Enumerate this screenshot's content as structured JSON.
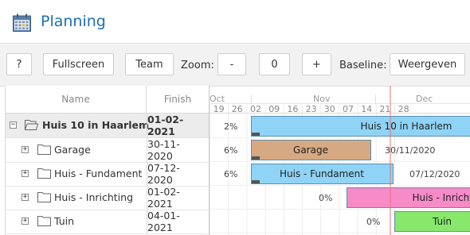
{
  "app": {
    "title": "Planning",
    "icon": "calendar-icon"
  },
  "toolbar": {
    "help_label": "?",
    "fullscreen_label": "Fullscreen",
    "team_label": "Team",
    "zoom_label": "Zoom:",
    "zoom_out_label": "-",
    "zoom_value": "0",
    "zoom_in_label": "+",
    "baseline_label": "Baseline:",
    "baseline_value": "Weergeven"
  },
  "grid": {
    "columns": {
      "name": "Name",
      "finish": "Finish"
    },
    "rows": [
      {
        "name": "Huis 10 in Haarlem",
        "finish": "01-02-2021",
        "toggle": "−",
        "expanded": true,
        "level": 0
      },
      {
        "name": "Garage",
        "finish": "30-11-2020",
        "toggle": "+",
        "expanded": false,
        "level": 1
      },
      {
        "name": "Huis - Fundament",
        "finish": "07-12-2020",
        "toggle": "+",
        "expanded": false,
        "level": 1
      },
      {
        "name": "Huis - Inrichting",
        "finish": "01-02-2021",
        "toggle": "+",
        "expanded": false,
        "level": 1
      },
      {
        "name": "Tuin",
        "finish": "04-01-2021",
        "toggle": "+",
        "expanded": false,
        "level": 1
      }
    ]
  },
  "timeline": {
    "months": [
      {
        "label": "Oct"
      },
      {
        "label": "Nov"
      },
      {
        "label": "Dec"
      }
    ],
    "days": [
      "19",
      "26",
      "02",
      "09",
      "16",
      "23",
      "30",
      "07",
      "14",
      "21",
      "28"
    ],
    "tasks": [
      {
        "label": "Huis 10 in Haarlem",
        "percent": "2%",
        "color": "#8fd4f6",
        "end_label": ""
      },
      {
        "label": "Garage",
        "percent": "6%",
        "color": "#d6a982",
        "end_label": "30/11/2020"
      },
      {
        "label": "Huis - Fundament",
        "percent": "6%",
        "color": "#8fd4f6",
        "end_label": "07/12/2020"
      },
      {
        "label": "Huis - Inrichting",
        "percent": "0%",
        "color": "#f78bc8",
        "end_label": ""
      },
      {
        "label": "Tuin",
        "percent": "0%",
        "color": "#88e86c",
        "end_label": ""
      }
    ],
    "today_color": "#e57373"
  }
}
